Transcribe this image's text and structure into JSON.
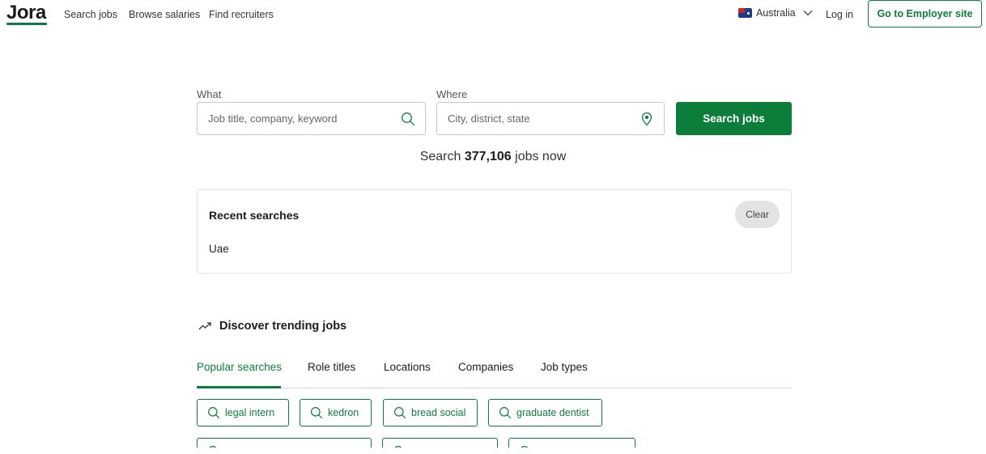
{
  "header": {
    "logo": "Jora",
    "nav": [
      "Search jobs",
      "Browse salaries",
      "Find recruiters"
    ],
    "country": "Australia",
    "login": "Log in",
    "employer_button": "Go to Employer site"
  },
  "search": {
    "what_label": "What",
    "what_placeholder": "Job title, company, keyword",
    "where_label": "Where",
    "where_placeholder": "City, district, state",
    "button": "Search jobs",
    "count_prefix": "Search ",
    "count": "377,106",
    "count_suffix": " jobs now"
  },
  "recent": {
    "title": "Recent searches",
    "clear": "Clear",
    "items": [
      "Uae"
    ]
  },
  "trending": {
    "title": "Discover trending jobs",
    "tabs": [
      "Popular searches",
      "Role titles",
      "Locations",
      "Companies",
      "Job types"
    ],
    "active_tab": "Popular searches",
    "chips": [
      "legal intern",
      "kedron",
      "bread social",
      "graduate dentist"
    ]
  },
  "colors": {
    "brand_green": "#0d7d3c"
  }
}
